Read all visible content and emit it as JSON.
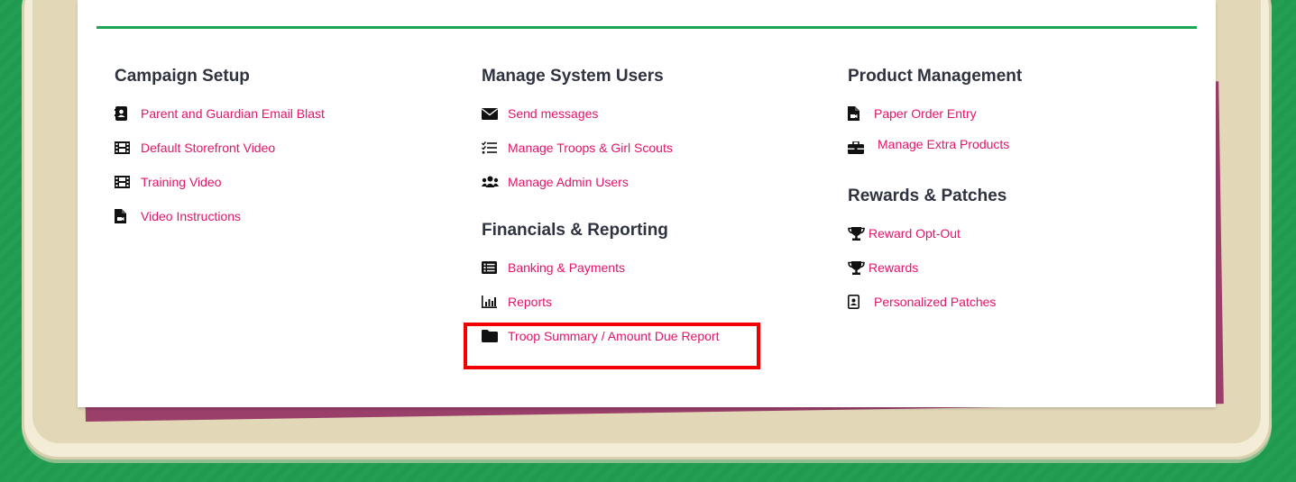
{
  "columns": [
    {
      "sections": [
        {
          "title": "Campaign Setup",
          "links": [
            {
              "label": "Parent and Guardian Email Blast",
              "icon": "contact-book-icon"
            },
            {
              "label": "Default Storefront Video",
              "icon": "film-icon"
            },
            {
              "label": "Training Video",
              "icon": "film-icon"
            },
            {
              "label": "Video Instructions",
              "icon": "video-file-icon"
            }
          ]
        }
      ]
    },
    {
      "sections": [
        {
          "title": "Manage System Users",
          "links": [
            {
              "label": "Send messages",
              "icon": "envelope-icon"
            },
            {
              "label": "Manage Troops & Girl Scouts",
              "icon": "checklist-icon"
            },
            {
              "label": "Manage Admin Users",
              "icon": "users-icon"
            }
          ]
        },
        {
          "title": "Financials & Reporting",
          "links": [
            {
              "label": "Banking & Payments",
              "icon": "list-alt-icon"
            },
            {
              "label": "Reports",
              "icon": "bar-chart-icon"
            },
            {
              "label": "Troop Summary / Amount Due Report",
              "icon": "folder-icon",
              "highlighted": true
            }
          ]
        }
      ]
    },
    {
      "sections": [
        {
          "title": "Product Management",
          "links": [
            {
              "label": "Paper Order Entry",
              "icon": "video-file-icon"
            },
            {
              "label": "Manage Extra Products",
              "icon": "toolbox-icon"
            }
          ]
        },
        {
          "title": "Rewards & Patches",
          "links": [
            {
              "label": "Reward Opt-Out",
              "icon": "trophy-icon"
            },
            {
              "label": "Rewards",
              "icon": "trophy-icon"
            },
            {
              "label": "Personalized Patches",
              "icon": "id-badge-icon"
            }
          ]
        }
      ]
    }
  ],
  "colors": {
    "link": "#e0156b",
    "title": "#2f3340",
    "divider": "#1aa654",
    "highlight": "#f20000"
  }
}
